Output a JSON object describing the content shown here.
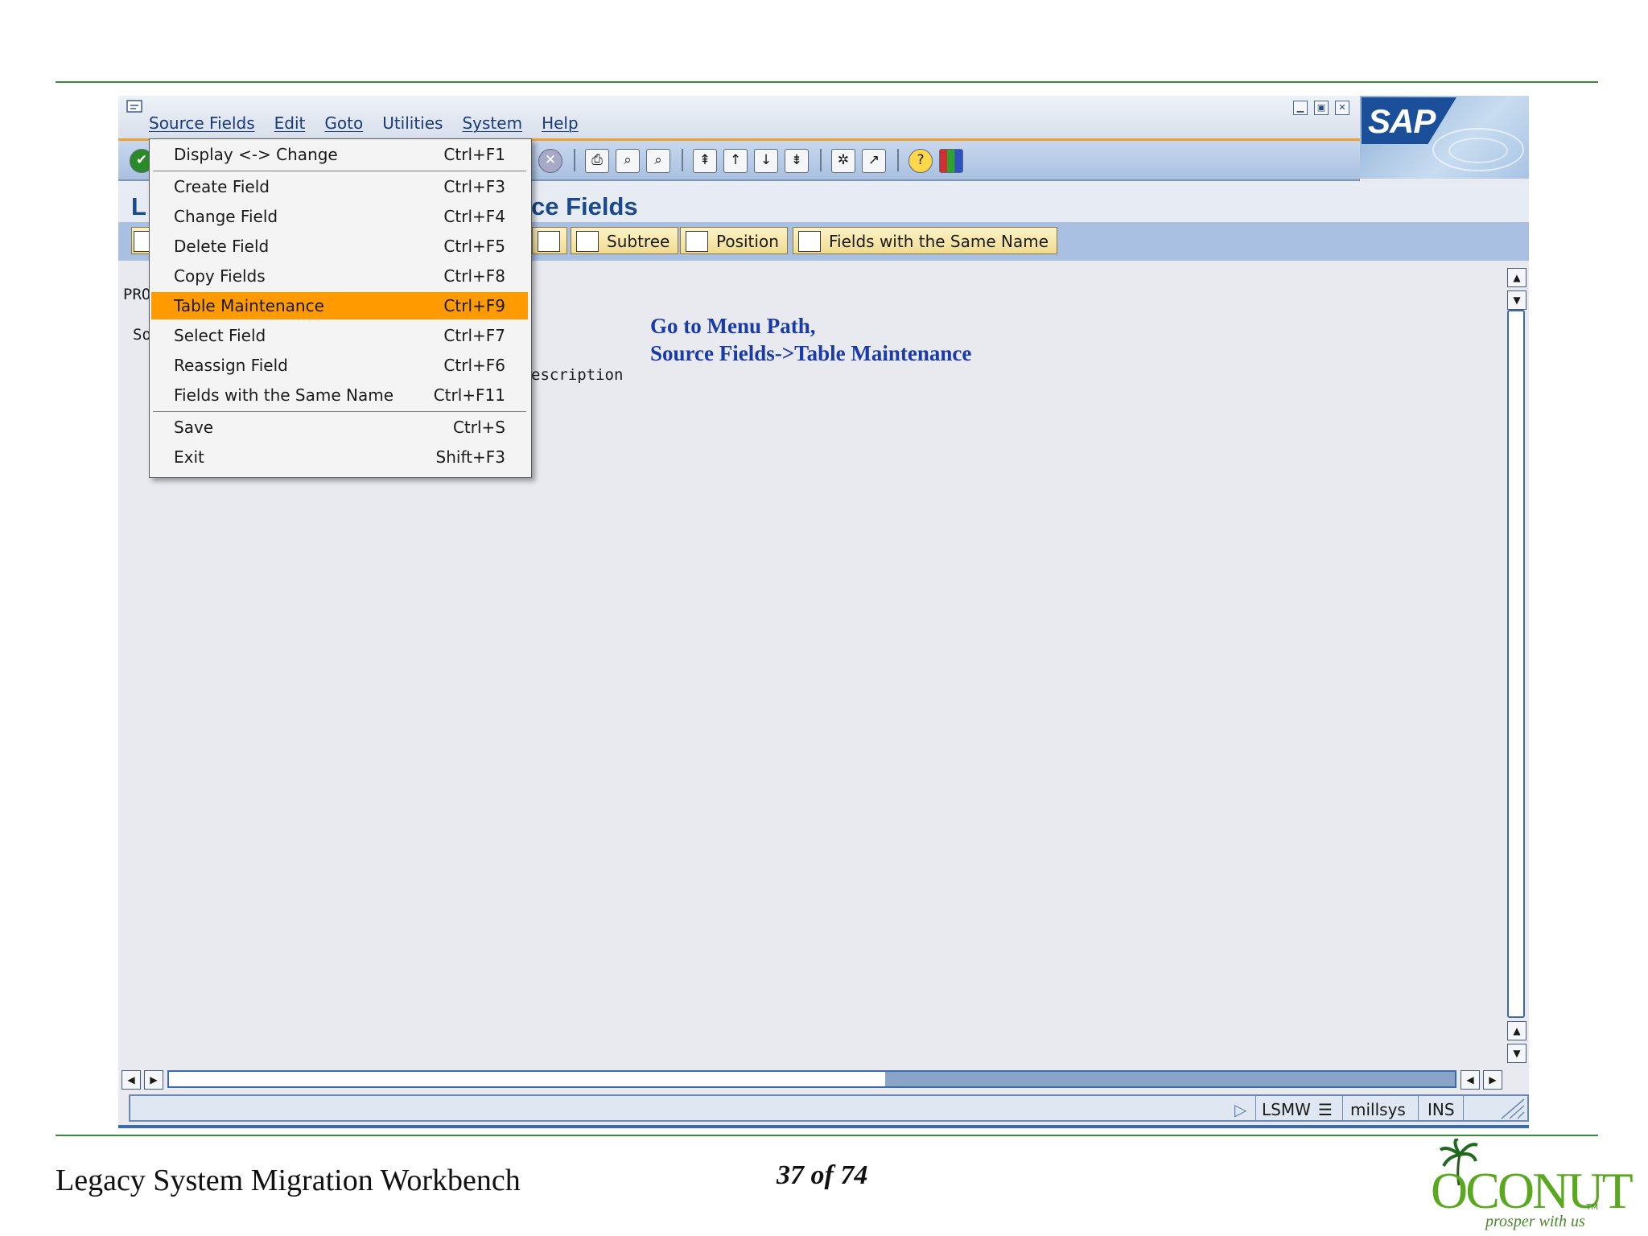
{
  "window": {
    "menus": [
      {
        "label": "Source Fields",
        "underlined": true
      },
      {
        "label": "Edit",
        "underlined": true
      },
      {
        "label": "Goto",
        "underlined": true
      },
      {
        "label": "Utilities",
        "underlined": false
      },
      {
        "label": "System",
        "underlined": true
      },
      {
        "label": "Help",
        "underlined": true
      }
    ],
    "window_controls": [
      "minimize-icon",
      "restore-icon",
      "close-icon"
    ],
    "logo_text": "SAP",
    "page_title": "ce Fields",
    "page_title_prefix": "L",
    "app_toolbar": {
      "subtree": "Subtree",
      "position": "Position",
      "same_name": "Fields with the Same Name"
    },
    "content": {
      "program_label": "PRO",
      "source_label": "So",
      "description_label": "escription"
    },
    "status": {
      "transaction": "LSMW",
      "server": "millsys",
      "mode": "INS"
    }
  },
  "dropdown": {
    "items": [
      {
        "label": "Display <-> Change",
        "shortcut": "Ctrl+F1",
        "selected": false
      },
      {
        "label": "Create Field",
        "shortcut": "Ctrl+F3",
        "selected": false
      },
      {
        "label": "Change Field",
        "shortcut": "Ctrl+F4",
        "selected": false
      },
      {
        "label": "Delete Field",
        "shortcut": "Ctrl+F5",
        "selected": false
      },
      {
        "label": "Copy Fields",
        "shortcut": "Ctrl+F8",
        "selected": false
      },
      {
        "label": "Table Maintenance",
        "shortcut": "Ctrl+F9",
        "selected": true
      },
      {
        "label": "Select Field",
        "shortcut": "Ctrl+F7",
        "selected": false
      },
      {
        "label": "Reassign Field",
        "shortcut": "Ctrl+F6",
        "selected": false
      },
      {
        "label": "Fields with the Same Name",
        "shortcut": "Ctrl+F11",
        "selected": false
      },
      {
        "label": "Save",
        "shortcut": "Ctrl+S",
        "selected": false
      },
      {
        "label": "Exit",
        "shortcut": "Shift+F3",
        "selected": false
      }
    ]
  },
  "annotation": {
    "line1": "Go to Menu Path,",
    "line2": "Source Fields->Table Maintenance"
  },
  "footer": {
    "title": "Legacy System Migration Workbench",
    "page": "37 of 74",
    "logo_text": "OCONUT",
    "logo_tagline": "prosper with us",
    "logo_tm": "TM"
  },
  "colors": {
    "menu_highlight": "#ff9a00",
    "title_blue": "#1a4a8a",
    "annotation_blue": "#1a3aa8",
    "rule_green": "#3a8a3a"
  }
}
